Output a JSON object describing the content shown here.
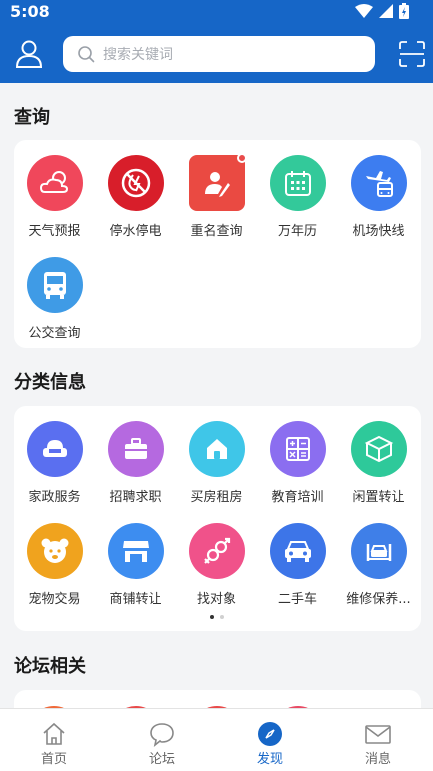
{
  "status_bar": {
    "time": "5:08"
  },
  "search": {
    "placeholder": "搜索关键词"
  },
  "sections": {
    "query": {
      "title": "查询",
      "items": [
        {
          "label": "天气预报",
          "icon": "weather-icon",
          "color": "#f0475b"
        },
        {
          "label": "停水停电",
          "icon": "no-water-power-icon",
          "color": "#d81e2a"
        },
        {
          "label": "重名查询",
          "icon": "name-search-icon",
          "color": "#ea4a42"
        },
        {
          "label": "万年历",
          "icon": "calendar-icon",
          "color": "#33c99a"
        },
        {
          "label": "机场快线",
          "icon": "airport-bus-icon",
          "color": "#3d7df0"
        },
        {
          "label": "公交查询",
          "icon": "bus-icon",
          "color": "#3f9be6"
        }
      ]
    },
    "classifieds": {
      "title": "分类信息",
      "items": [
        {
          "label": "家政服务",
          "icon": "sofa-icon",
          "color": "#5a6ff0"
        },
        {
          "label": "招聘求职",
          "icon": "briefcase-icon",
          "color": "#b569e0"
        },
        {
          "label": "买房租房",
          "icon": "house-icon",
          "color": "#3fc6e8"
        },
        {
          "label": "教育培训",
          "icon": "calculator-icon",
          "color": "#8b6ef0"
        },
        {
          "label": "闲置转让",
          "icon": "box-icon",
          "color": "#2ec99a"
        },
        {
          "label": "宠物交易",
          "icon": "pet-icon",
          "color": "#f0a31e"
        },
        {
          "label": "商铺转让",
          "icon": "shop-icon",
          "color": "#3d8df0"
        },
        {
          "label": "找对象",
          "icon": "gender-icon",
          "color": "#f0528a"
        },
        {
          "label": "二手车",
          "icon": "car-icon",
          "color": "#3d75e8"
        },
        {
          "label": "维修保养...",
          "icon": "car-repair-icon",
          "color": "#3f7fe8"
        }
      ]
    },
    "forum": {
      "title": "论坛相关"
    }
  },
  "tabbar": {
    "tabs": [
      {
        "label": "首页",
        "icon": "home-icon"
      },
      {
        "label": "论坛",
        "icon": "chat-icon"
      },
      {
        "label": "发现",
        "icon": "compass-icon",
        "active": true
      },
      {
        "label": "消息",
        "icon": "mail-icon"
      }
    ]
  },
  "colors": {
    "header": "#1666c7",
    "accent": "#1666c7"
  }
}
